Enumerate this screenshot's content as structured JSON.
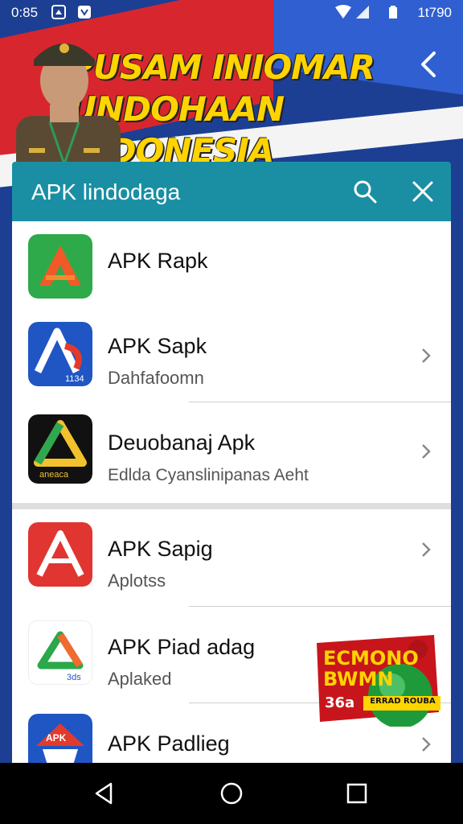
{
  "status_bar": {
    "time": "0:85",
    "clock_right": "1t790",
    "icons": [
      "home-icon",
      "notification-icon",
      "wifi-icon",
      "signal-icon",
      "battery-icon"
    ]
  },
  "banner": {
    "headline_line1": "PUSAM INIOMAR",
    "headline_line2": "UNDOHAAN INDONESIA"
  },
  "search": {
    "query": "APK lindodaga"
  },
  "apps": [
    {
      "title": "APK Rapk",
      "subtitle": "",
      "icon": "orange-a-icon",
      "has_chevron": false
    },
    {
      "title": "APK Sapk",
      "subtitle": "Dahfafoomn",
      "icon": "blue-a-icon",
      "icon_text": "1134",
      "has_chevron": true
    },
    {
      "title": "Deuobanaj Apk",
      "subtitle": "Edlda Cyanslinipanas Aeht",
      "icon": "triangle-a-icon",
      "icon_text": "aneaca",
      "has_chevron": true
    },
    {
      "title": "APK Sapig",
      "subtitle": "Aplotss",
      "icon": "red-a-icon",
      "has_chevron": true
    },
    {
      "title": "APK Piad adag",
      "subtitle": "Aplaked",
      "icon": "green-a-icon",
      "icon_text": "3ds",
      "has_chevron": false
    },
    {
      "title": "APK Padlieg",
      "subtitle": "",
      "icon": "apk-ship-icon",
      "icon_text": "APK",
      "has_chevron": true
    }
  ],
  "promo": {
    "line1": "ECMONO",
    "line2": "BWMN",
    "line3": "36a",
    "ribbon": "ERRAD ROUBA"
  },
  "colors": {
    "header_teal": "#1a8fa3",
    "banner_blue": "#1c3f93",
    "banner_red": "#d8262e",
    "headline_yellow": "#ffd400"
  }
}
